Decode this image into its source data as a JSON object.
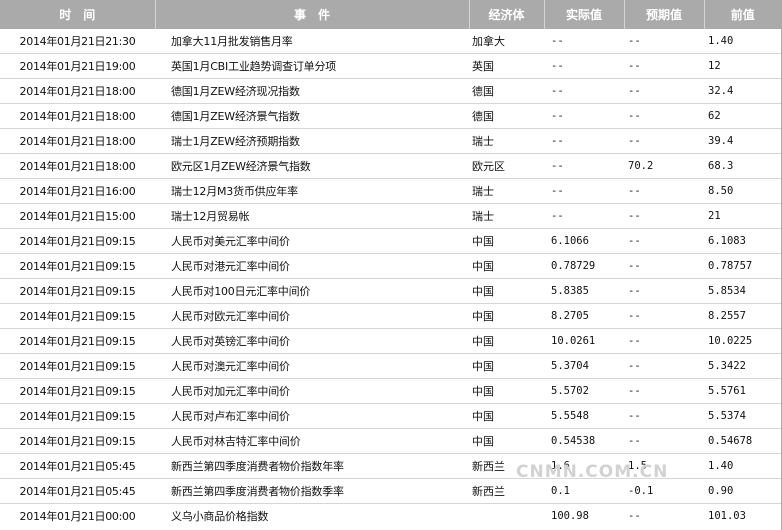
{
  "headers": {
    "time": "时间",
    "event": "事件",
    "economy": "经济体",
    "actual": "实际值",
    "expected": "预期值",
    "previous": "前值"
  },
  "rows": [
    {
      "time": "2014年01月21日21:30",
      "event": "加拿大11月批发销售月率",
      "economy": "加拿大",
      "actual": "--",
      "expected": "--",
      "previous": "1.40"
    },
    {
      "time": "2014年01月21日19:00",
      "event": "英国1月CBI工业趋势调查订单分项",
      "economy": "英国",
      "actual": "--",
      "expected": "--",
      "previous": "12"
    },
    {
      "time": "2014年01月21日18:00",
      "event": "德国1月ZEW经济现况指数",
      "economy": "德国",
      "actual": "--",
      "expected": "--",
      "previous": "32.4"
    },
    {
      "time": "2014年01月21日18:00",
      "event": "德国1月ZEW经济景气指数",
      "economy": "德国",
      "actual": "--",
      "expected": "--",
      "previous": "62"
    },
    {
      "time": "2014年01月21日18:00",
      "event": "瑞士1月ZEW经济预期指数",
      "economy": "瑞士",
      "actual": "--",
      "expected": "--",
      "previous": "39.4"
    },
    {
      "time": "2014年01月21日18:00",
      "event": "欧元区1月ZEW经济景气指数",
      "economy": "欧元区",
      "actual": "--",
      "expected": "70.2",
      "previous": "68.3"
    },
    {
      "time": "2014年01月21日16:00",
      "event": "瑞士12月M3货币供应年率",
      "economy": "瑞士",
      "actual": "--",
      "expected": "--",
      "previous": "8.50"
    },
    {
      "time": "2014年01月21日15:00",
      "event": "瑞士12月贸易帐",
      "economy": "瑞士",
      "actual": "--",
      "expected": "--",
      "previous": "21"
    },
    {
      "time": "2014年01月21日09:15",
      "event": "人民币对美元汇率中间价",
      "economy": "中国",
      "actual": "6.1066",
      "expected": "--",
      "previous": "6.1083"
    },
    {
      "time": "2014年01月21日09:15",
      "event": "人民币对港元汇率中间价",
      "economy": "中国",
      "actual": "0.78729",
      "expected": "--",
      "previous": "0.78757"
    },
    {
      "time": "2014年01月21日09:15",
      "event": "人民币对100日元汇率中间价",
      "economy": "中国",
      "actual": "5.8385",
      "expected": "--",
      "previous": "5.8534"
    },
    {
      "time": "2014年01月21日09:15",
      "event": "人民币对欧元汇率中间价",
      "economy": "中国",
      "actual": "8.2705",
      "expected": "--",
      "previous": "8.2557"
    },
    {
      "time": "2014年01月21日09:15",
      "event": "人民币对英镑汇率中间价",
      "economy": "中国",
      "actual": "10.0261",
      "expected": "--",
      "previous": "10.0225"
    },
    {
      "time": "2014年01月21日09:15",
      "event": "人民币对澳元汇率中间价",
      "economy": "中国",
      "actual": "5.3704",
      "expected": "--",
      "previous": "5.3422"
    },
    {
      "time": "2014年01月21日09:15",
      "event": "人民币对加元汇率中间价",
      "economy": "中国",
      "actual": "5.5702",
      "expected": "--",
      "previous": "5.5761"
    },
    {
      "time": "2014年01月21日09:15",
      "event": "人民币对卢布汇率中间价",
      "economy": "中国",
      "actual": "5.5548",
      "expected": "--",
      "previous": "5.5374"
    },
    {
      "time": "2014年01月21日09:15",
      "event": "人民币对林吉特汇率中间价",
      "economy": "中国",
      "actual": "0.54538",
      "expected": "--",
      "previous": "0.54678"
    },
    {
      "time": "2014年01月21日05:45",
      "event": "新西兰第四季度消费者物价指数年率",
      "economy": "新西兰",
      "actual": "1.6",
      "expected": "1.5",
      "previous": "1.40"
    },
    {
      "time": "2014年01月21日05:45",
      "event": "新西兰第四季度消费者物价指数季率",
      "economy": "新西兰",
      "actual": "0.1",
      "expected": "-0.1",
      "previous": "0.90"
    },
    {
      "time": "2014年01月21日00:00",
      "event": "义乌小商品价格指数",
      "economy": "",
      "actual": "100.98",
      "expected": "--",
      "previous": "101.03"
    }
  ],
  "watermark": "CNMN.COM.CN"
}
